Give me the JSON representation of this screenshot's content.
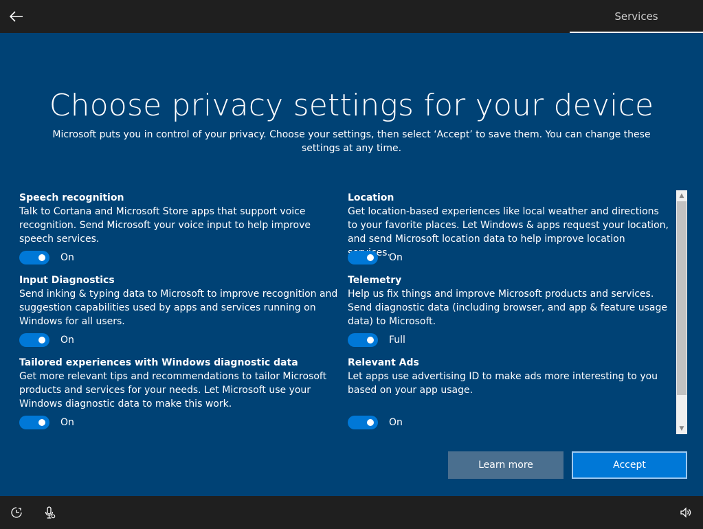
{
  "header": {
    "back_icon": "back-arrow-icon",
    "tab_label": "Services"
  },
  "main": {
    "title": "Choose privacy settings for your device",
    "subtitle": "Microsoft puts you in control of your privacy. Choose your settings, then select ‘Accept’ to save them. You can change these settings at any time."
  },
  "settings": {
    "left": [
      {
        "title": "Speech recognition",
        "description": "Talk to Cortana and Microsoft Store apps that support voice recognition. Send Microsoft your voice input to help improve speech services.",
        "state": "On"
      },
      {
        "title": "Input Diagnostics",
        "description": "Send inking & typing data to Microsoft to improve recognition and suggestion capabilities used by apps and services running on Windows for all users.",
        "state": "On"
      },
      {
        "title": "Tailored experiences with Windows diagnostic data",
        "description": "Get more relevant tips and recommendations to tailor Microsoft products and services for your needs. Let Microsoft use your Windows diagnostic data to make this work.",
        "state": "On"
      }
    ],
    "right": [
      {
        "title": "Location",
        "description": "Get location-based experiences like local weather and directions to your favorite places. Let Windows & apps request your location, and send Microsoft location data to help improve location services.",
        "state": "On"
      },
      {
        "title": "Telemetry",
        "description": "Help us fix things and improve Microsoft products and services. Send diagnostic data (including browser, and app & feature usage data) to Microsoft.",
        "state": "Full"
      },
      {
        "title": "Relevant Ads",
        "description": "Let apps use advertising ID to make ads more interesting to you based on your app usage.",
        "state": "On"
      }
    ]
  },
  "buttons": {
    "learn_more": "Learn more",
    "accept": "Accept"
  },
  "footer": {
    "icons": [
      "ease-of-access-icon",
      "microphone-icon",
      "volume-icon"
    ]
  },
  "colors": {
    "background": "#004275",
    "toggle_on": "#0078d7",
    "accept": "#0078d7",
    "learn_more": "#4a6f8f",
    "bar": "#1f1f1f"
  }
}
